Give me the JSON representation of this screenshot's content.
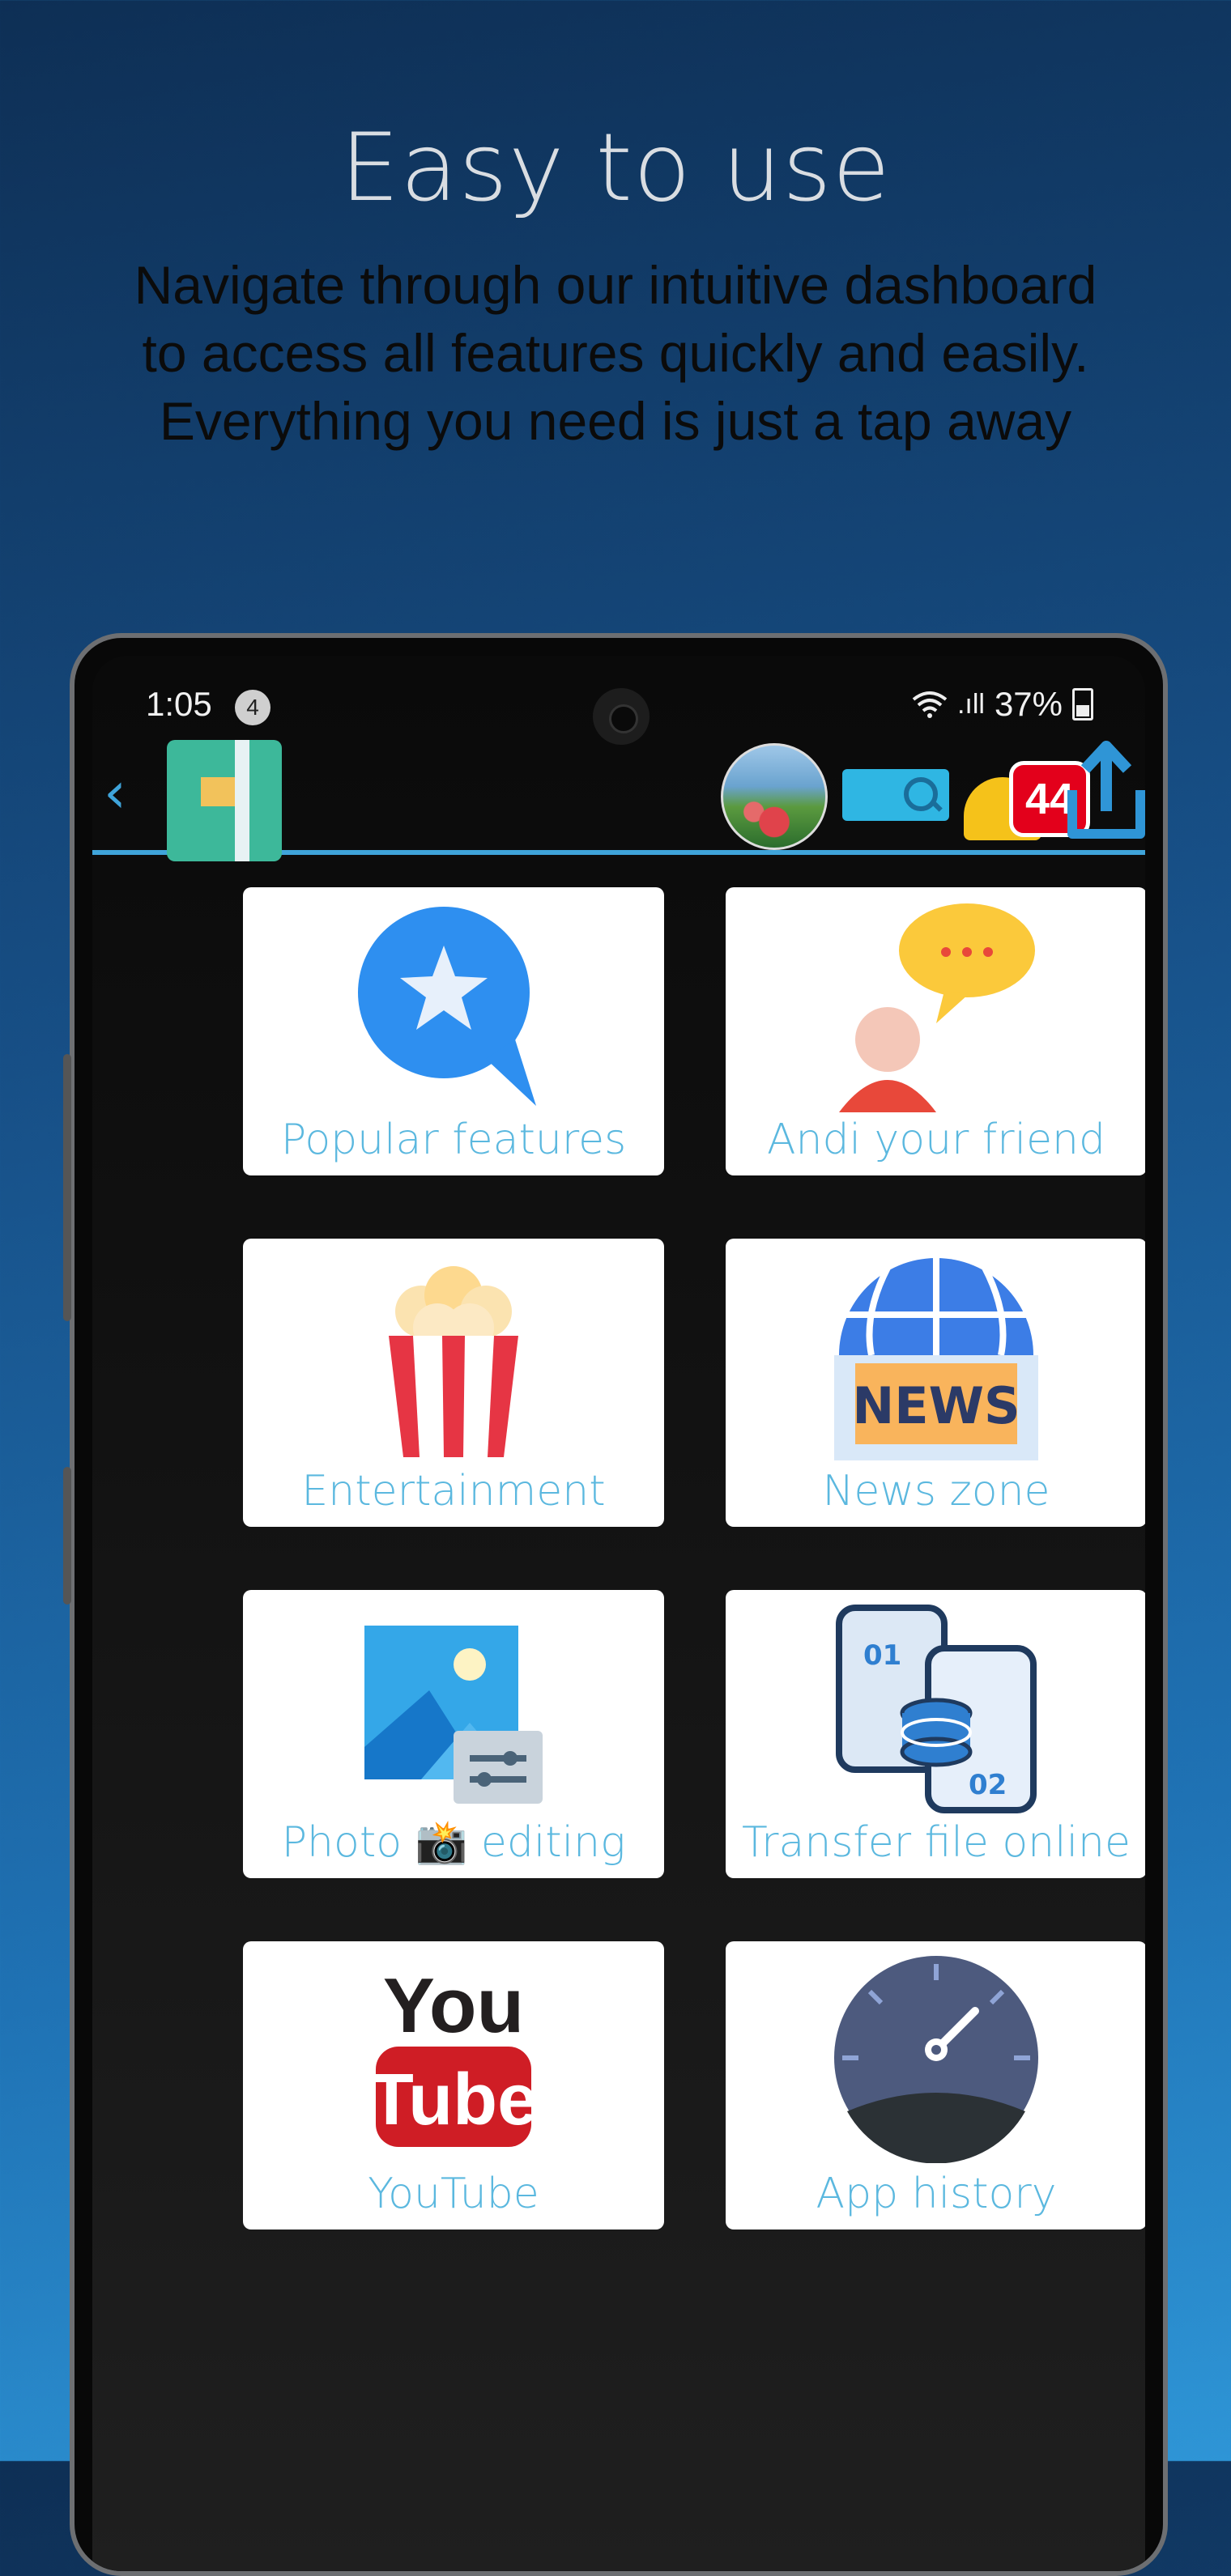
{
  "promo": {
    "headline": "Easy to use",
    "subline": "Navigate through our intuitive dashboard to access all features quickly and easily. Everything you need is just a tap away"
  },
  "statusbar": {
    "time": "1:05",
    "notification_count": "4",
    "signal_text": ".ıll",
    "battery_percent": "37%"
  },
  "appbar": {
    "back_icon": "chevron-left-icon",
    "notebook_icon": "notebook-icon",
    "avatar_icon": "avatar",
    "search_icon": "search-icon",
    "bell_badge": "44",
    "share_icon": "share-icon"
  },
  "tiles": [
    {
      "label": "Popular features",
      "icon": "star-chat-icon"
    },
    {
      "label": "Andi your friend",
      "icon": "person-speech-icon"
    },
    {
      "label": "Entertainment",
      "icon": "popcorn-icon"
    },
    {
      "label": "News zone",
      "icon": "news-globe-icon"
    },
    {
      "label": "Photo 📸 editing",
      "icon": "photo-edit-icon"
    },
    {
      "label": "Transfer file online",
      "icon": "phone-transfer-icon"
    },
    {
      "label": "YouTube",
      "icon": "youtube-icon"
    },
    {
      "label": "App history",
      "icon": "gauge-icon"
    }
  ],
  "colors": {
    "accent": "#3fa4da",
    "tile_text": "#5bb8df",
    "badge_red": "#e3001b",
    "bell_yellow": "#f5c21a"
  }
}
